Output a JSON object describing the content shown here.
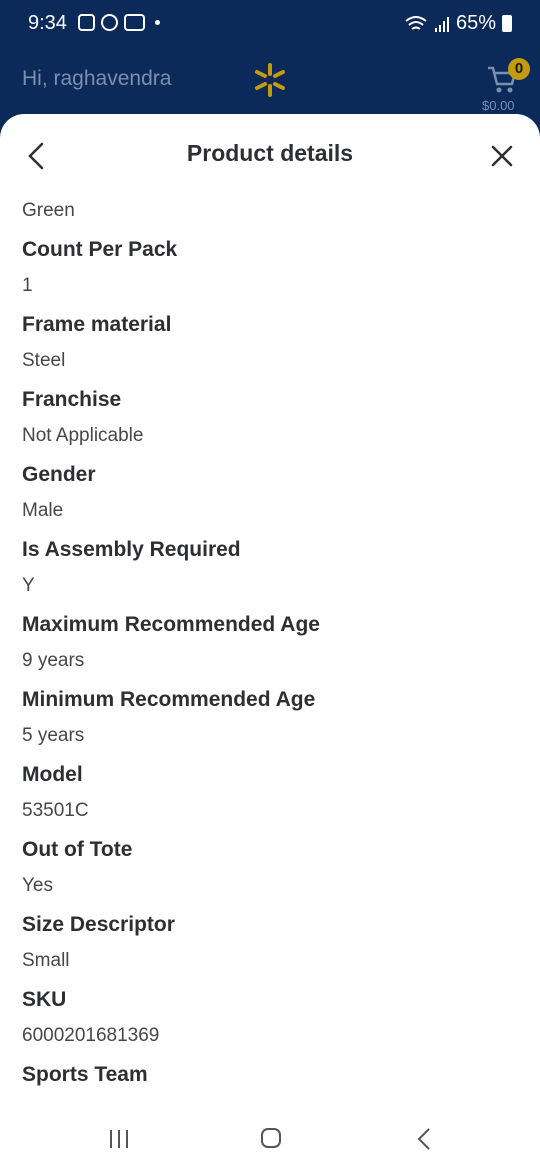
{
  "status_bar": {
    "time": "9:34",
    "battery": "65%",
    "icons": [
      "gallery-icon",
      "notification-icon",
      "youtube-icon",
      "wifi-icon",
      "signal-icon",
      "battery-icon"
    ]
  },
  "header": {
    "greeting": "Hi, raghavendra",
    "cart_count": "0",
    "cart_total": "$0.00",
    "brand_color": "#0b2a5a",
    "spark_color": "#c49a10"
  },
  "sheet": {
    "title": "Product details"
  },
  "details": {
    "top_value": "Green",
    "items": [
      {
        "label": "Count Per Pack",
        "value": "1"
      },
      {
        "label": "Frame material",
        "value": "Steel"
      },
      {
        "label": "Franchise",
        "value": "Not Applicable"
      },
      {
        "label": "Gender",
        "value": "Male"
      },
      {
        "label": "Is Assembly Required",
        "value": "Y"
      },
      {
        "label": "Maximum Recommended Age",
        "value": "9 years"
      },
      {
        "label": "Minimum Recommended Age",
        "value": "5 years"
      },
      {
        "label": "Model",
        "value": "53501C"
      },
      {
        "label": "Out of Tote",
        "value": "Yes"
      },
      {
        "label": "Size Descriptor",
        "value": "Small"
      },
      {
        "label": "SKU",
        "value": "6000201681369"
      },
      {
        "label": "Sports Team",
        "value": ""
      }
    ]
  }
}
